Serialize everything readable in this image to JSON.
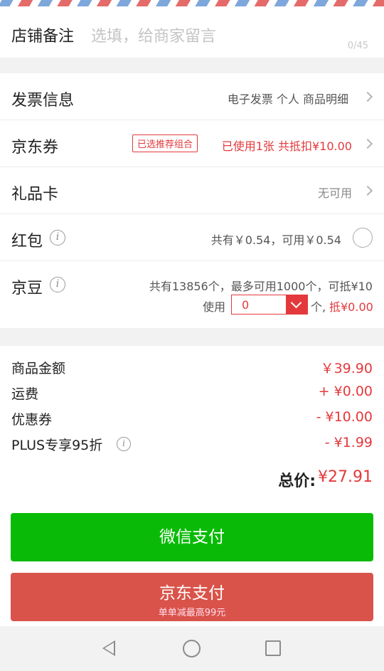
{
  "remark": {
    "label": "店铺备注",
    "placeholder": "选填，给商家留言",
    "counter": "0/45"
  },
  "invoice": {
    "title": "发票信息",
    "value": "电子发票 个人 商品明细"
  },
  "coupon": {
    "title": "京东券",
    "tag": "已选推荐组合",
    "value": "已使用1张 共抵扣¥10.00"
  },
  "giftcard": {
    "title": "礼品卡",
    "value": "无可用"
  },
  "redpacket": {
    "title": "红包",
    "value": "共有￥0.54，可用￥0.54",
    "selected": false
  },
  "jdbean": {
    "title": "京豆",
    "summary": "共有13856个，最多可用1000个，可抵¥10",
    "use_label": "使用",
    "use_value": "0",
    "unit_label": "个,",
    "deduct": "抵¥0.00"
  },
  "summary": {
    "lines": [
      {
        "label": "商品金额",
        "amount": "￥39.90"
      },
      {
        "label": "运费",
        "amount": "+ ¥0.00"
      },
      {
        "label": "优惠券",
        "amount": "- ¥10.00"
      },
      {
        "label": "PLUS专享95折",
        "amount": "- ¥1.99"
      }
    ],
    "total_label": "总价:",
    "total_value": "¥27.91"
  },
  "payment": {
    "wechat_label": "微信支付",
    "jd_label": "京东支付",
    "jd_sublabel": "单单减最高99元"
  },
  "icons": {
    "info": "info-icon",
    "chevron": "chevron-right-icon",
    "dropdown": "chevron-down-icon"
  },
  "colors": {
    "accent_red": "#e4393c",
    "wechat_green": "#09bb07",
    "jd_pay_red": "#d9534a"
  }
}
